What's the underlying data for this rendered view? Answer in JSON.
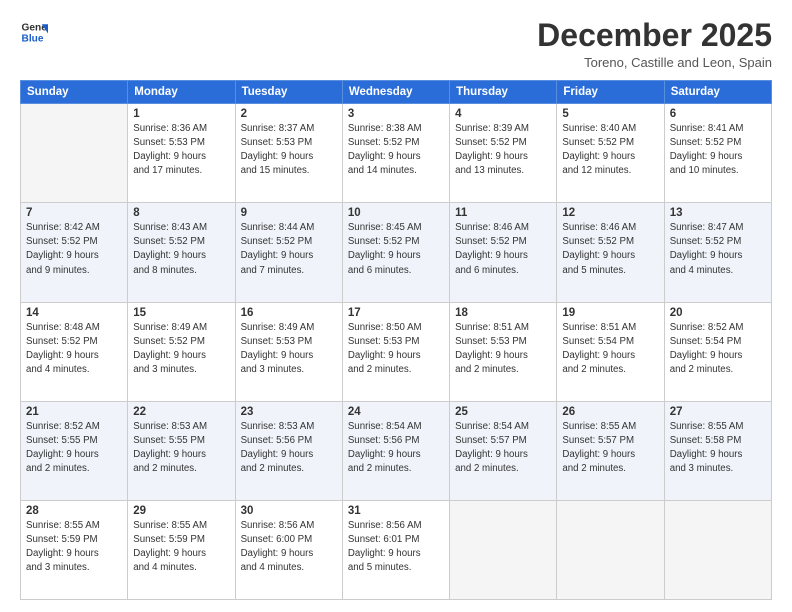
{
  "logo": {
    "line1": "General",
    "line2": "Blue"
  },
  "title": "December 2025",
  "location": "Toreno, Castille and Leon, Spain",
  "days_header": [
    "Sunday",
    "Monday",
    "Tuesday",
    "Wednesday",
    "Thursday",
    "Friday",
    "Saturday"
  ],
  "weeks": [
    [
      {
        "num": "",
        "info": ""
      },
      {
        "num": "1",
        "info": "Sunrise: 8:36 AM\nSunset: 5:53 PM\nDaylight: 9 hours\nand 17 minutes."
      },
      {
        "num": "2",
        "info": "Sunrise: 8:37 AM\nSunset: 5:53 PM\nDaylight: 9 hours\nand 15 minutes."
      },
      {
        "num": "3",
        "info": "Sunrise: 8:38 AM\nSunset: 5:52 PM\nDaylight: 9 hours\nand 14 minutes."
      },
      {
        "num": "4",
        "info": "Sunrise: 8:39 AM\nSunset: 5:52 PM\nDaylight: 9 hours\nand 13 minutes."
      },
      {
        "num": "5",
        "info": "Sunrise: 8:40 AM\nSunset: 5:52 PM\nDaylight: 9 hours\nand 12 minutes."
      },
      {
        "num": "6",
        "info": "Sunrise: 8:41 AM\nSunset: 5:52 PM\nDaylight: 9 hours\nand 10 minutes."
      }
    ],
    [
      {
        "num": "7",
        "info": "Sunrise: 8:42 AM\nSunset: 5:52 PM\nDaylight: 9 hours\nand 9 minutes."
      },
      {
        "num": "8",
        "info": "Sunrise: 8:43 AM\nSunset: 5:52 PM\nDaylight: 9 hours\nand 8 minutes."
      },
      {
        "num": "9",
        "info": "Sunrise: 8:44 AM\nSunset: 5:52 PM\nDaylight: 9 hours\nand 7 minutes."
      },
      {
        "num": "10",
        "info": "Sunrise: 8:45 AM\nSunset: 5:52 PM\nDaylight: 9 hours\nand 6 minutes."
      },
      {
        "num": "11",
        "info": "Sunrise: 8:46 AM\nSunset: 5:52 PM\nDaylight: 9 hours\nand 6 minutes."
      },
      {
        "num": "12",
        "info": "Sunrise: 8:46 AM\nSunset: 5:52 PM\nDaylight: 9 hours\nand 5 minutes."
      },
      {
        "num": "13",
        "info": "Sunrise: 8:47 AM\nSunset: 5:52 PM\nDaylight: 9 hours\nand 4 minutes."
      }
    ],
    [
      {
        "num": "14",
        "info": "Sunrise: 8:48 AM\nSunset: 5:52 PM\nDaylight: 9 hours\nand 4 minutes."
      },
      {
        "num": "15",
        "info": "Sunrise: 8:49 AM\nSunset: 5:52 PM\nDaylight: 9 hours\nand 3 minutes."
      },
      {
        "num": "16",
        "info": "Sunrise: 8:49 AM\nSunset: 5:53 PM\nDaylight: 9 hours\nand 3 minutes."
      },
      {
        "num": "17",
        "info": "Sunrise: 8:50 AM\nSunset: 5:53 PM\nDaylight: 9 hours\nand 2 minutes."
      },
      {
        "num": "18",
        "info": "Sunrise: 8:51 AM\nSunset: 5:53 PM\nDaylight: 9 hours\nand 2 minutes."
      },
      {
        "num": "19",
        "info": "Sunrise: 8:51 AM\nSunset: 5:54 PM\nDaylight: 9 hours\nand 2 minutes."
      },
      {
        "num": "20",
        "info": "Sunrise: 8:52 AM\nSunset: 5:54 PM\nDaylight: 9 hours\nand 2 minutes."
      }
    ],
    [
      {
        "num": "21",
        "info": "Sunrise: 8:52 AM\nSunset: 5:55 PM\nDaylight: 9 hours\nand 2 minutes."
      },
      {
        "num": "22",
        "info": "Sunrise: 8:53 AM\nSunset: 5:55 PM\nDaylight: 9 hours\nand 2 minutes."
      },
      {
        "num": "23",
        "info": "Sunrise: 8:53 AM\nSunset: 5:56 PM\nDaylight: 9 hours\nand 2 minutes."
      },
      {
        "num": "24",
        "info": "Sunrise: 8:54 AM\nSunset: 5:56 PM\nDaylight: 9 hours\nand 2 minutes."
      },
      {
        "num": "25",
        "info": "Sunrise: 8:54 AM\nSunset: 5:57 PM\nDaylight: 9 hours\nand 2 minutes."
      },
      {
        "num": "26",
        "info": "Sunrise: 8:55 AM\nSunset: 5:57 PM\nDaylight: 9 hours\nand 2 minutes."
      },
      {
        "num": "27",
        "info": "Sunrise: 8:55 AM\nSunset: 5:58 PM\nDaylight: 9 hours\nand 3 minutes."
      }
    ],
    [
      {
        "num": "28",
        "info": "Sunrise: 8:55 AM\nSunset: 5:59 PM\nDaylight: 9 hours\nand 3 minutes."
      },
      {
        "num": "29",
        "info": "Sunrise: 8:55 AM\nSunset: 5:59 PM\nDaylight: 9 hours\nand 4 minutes."
      },
      {
        "num": "30",
        "info": "Sunrise: 8:56 AM\nSunset: 6:00 PM\nDaylight: 9 hours\nand 4 minutes."
      },
      {
        "num": "31",
        "info": "Sunrise: 8:56 AM\nSunset: 6:01 PM\nDaylight: 9 hours\nand 5 minutes."
      },
      {
        "num": "",
        "info": ""
      },
      {
        "num": "",
        "info": ""
      },
      {
        "num": "",
        "info": ""
      }
    ]
  ]
}
